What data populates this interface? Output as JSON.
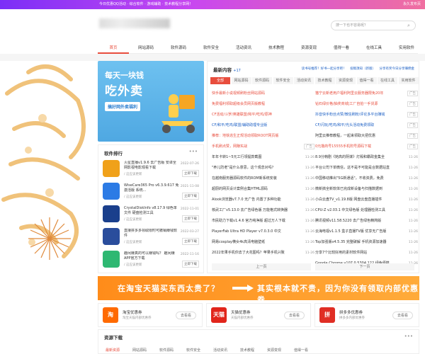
{
  "topbar": {
    "notice": "今日优惠QQ活动 · 综合软件 · 游戏辅助 · 技术教程分享网！",
    "right": "永久发布页"
  },
  "search": {
    "placeholder": "搜一下也不容易呢？"
  },
  "nav": [
    "首页",
    "网站源码",
    "软件源码",
    "软件安全",
    "活动资讯",
    "技术教程",
    "资源变现",
    "值得一看",
    "在线工具",
    "实用软件"
  ],
  "banner": {
    "line1": "每天一块钱",
    "line2": "吃外卖",
    "line3": "搞好网外卖福利"
  },
  "rank": {
    "title": "软件排行",
    "more": "•••",
    "items": [
      {
        "name": "火星直播v1.9.6 去广告版 安卓全网影视电影观看下载",
        "meta": "/ 这应该更新",
        "date": "2022-07-26",
        "btn": "立即下载",
        "color": "#f0a11a"
      },
      {
        "name": "WiseCare365 Pro v6.3.9.617 免激活版 系统...",
        "meta": "/ 这应该更新",
        "date": "2021-11-08",
        "btn": "立即下载",
        "color": "#2c7be5"
      },
      {
        "name": "CrystalDiskInfo v8.17.9 绿色单文件 硬盘检测工具",
        "meta": "/ 这应该更新",
        "date": "2022-11-01",
        "btn": "立即下载",
        "color": "#1a3f8c"
      },
      {
        "name": "直接拼多多领取限时可撤销赚钱软件",
        "meta": "/ 这应该更新",
        "date": "2022-03-27",
        "btn": "立即下载",
        "color": "#2a4d9c"
      },
      {
        "name": "趣闲赚真的可以赚钱吗？ 趣闲赚APP官方下载",
        "meta": "/ 这应该更新",
        "date": "2022-11-16",
        "btn": "立即下载",
        "color": "#2eb872"
      }
    ]
  },
  "latest": {
    "title": "最新内容",
    "count": "+17",
    "link1": "读书号推荐！好书一起分享吧！",
    "link2": "投稿须知（新版）",
    "link3": "分享有奖今日分享赚佣金",
    "tabs": [
      "全部",
      "网站源码",
      "软件源码",
      "软件安全",
      "活动资讯",
      "技术教程",
      "资源变现",
      "值得一看",
      "在线工具",
      "实用软件"
    ],
    "left": [
      {
        "t": "快手最新小说视频刷粉丝网站源码",
        "c": "red",
        "r": ""
      },
      {
        "t": "免费福利领取超级会员网页版教程",
        "c": "red",
        "r": ""
      },
      {
        "t": "CF活动/斗罗/英雄联盟/和平/吃鸡/原神",
        "c": "red",
        "r": ""
      },
      {
        "t": "CF/和平/吃鸡/联盟/辅助助理专业版",
        "c": "blue",
        "r": ""
      },
      {
        "t": "推荐：地铁逃生正规活动领取ROOT网页版",
        "c": "red",
        "r": ""
      },
      {
        "t": "手机刷点赞，网赚实战",
        "c": "red",
        "r": "广告"
      },
      {
        "t": "年年卡转1~5元工行领提款截图",
        "c": "",
        "r": "11-26"
      },
      {
        "t": "\"养儿防老\"是什么意思，这个观念对吗？",
        "c": "",
        "r": "11-26"
      },
      {
        "t": "在越南服务器源码软件的ROM新系统安装",
        "c": "",
        "r": "11-26"
      },
      {
        "t": "超厨的网页设计案例合集HTML源码",
        "c": "",
        "r": "11-26"
      },
      {
        "t": "Alook浏览器v7.7.0 无广告 内置了多种功能",
        "c": "",
        "r": "11-26"
      },
      {
        "t": "核武工厂v5.13.0 去广告绿色版 万能格式转换器",
        "c": "",
        "r": "11-26"
      },
      {
        "t": "市民助力下载v1.4.6 官方纯净版 超过万人下载",
        "c": "",
        "r": "11-26"
      },
      {
        "t": "PlayerFab Ultra HD Player v7.0.3.0 中文",
        "c": "",
        "r": "11-26"
      },
      {
        "t": "网易cosplay横女4k高清电脑壁纸",
        "c": "",
        "r": "11-26"
      },
      {
        "t": "2022年果手机你去了大花图吗？苹果手机兴致",
        "c": "",
        "r": "11-26"
      }
    ],
    "right": [
      {
        "t": "猫宁云新老用户福利阿里云服务器限免20年",
        "c": "red",
        "r": "广告"
      },
      {
        "t": "钻石绿价格/抽奖商城|工厂自拍一手货源",
        "c": "red",
        "r": "广告"
      },
      {
        "t": "抖音快手粉丝点赞/微信刷粉/评论多平台赚钱",
        "c": "blue",
        "r": "广告"
      },
      {
        "t": "CF/闪玩/吃鸡/和平/光头活动免费领取",
        "c": "blue",
        "r": "广告"
      },
      {
        "t": "阿里云推荐教程，一起来领取大把优惠",
        "c": "",
        "r": "广告"
      },
      {
        "t": "0元撸商号15555手机附号源码下载",
        "c": "red",
        "r": "广告"
      },
      {
        "t": "8.9分韩剧《她高的阴谋》灯殿和霸政金集全",
        "c": "",
        "r": "11-26"
      },
      {
        "t": "平台公司下单微信，这不是不可能是合数据站直",
        "c": "",
        "r": "11-26"
      },
      {
        "t": "中国移动推出\"5G新通话\"，不收资费，免费",
        "c": "",
        "r": "11-26"
      },
      {
        "t": "微新搞全新软体已完成新设备与扫描数据到",
        "c": "",
        "r": "11-26"
      },
      {
        "t": "小白云盘TV_v1.19.8版 网盘云盘直播插件",
        "c": "",
        "r": "11-26"
      },
      {
        "t": "CPU-Z v2.03.1 中文绿色版 处理器检测工具",
        "c": "",
        "r": "11-26"
      },
      {
        "t": "腾讯视频v11.58.5220 去广告绿色精简版",
        "c": "",
        "r": "11-26"
      },
      {
        "t": "云海电视v1.1.5 盒子直播TV版 优享无广告版",
        "c": "",
        "r": "11-26"
      },
      {
        "t": "Top加强版v4.5.35 完整破解 手机资源加速器",
        "c": "",
        "r": "11-26"
      },
      {
        "t": "分享7个比较好用的素材软件网站",
        "c": "",
        "r": "11-26"
      },
      {
        "t": "Google Chrome v107.0.5304.122 绿色便携",
        "c": "",
        "r": "11-26"
      }
    ],
    "prev": "上一页",
    "next": "下一页"
  },
  "bigbanner": {
    "left": "在淘宝天猫买东西太贵了？",
    "right": "其实根本就不贵，因为你没有领取内部优惠券"
  },
  "coupons": [
    {
      "title": "淘宝优惠券",
      "sub": "淘宝天猫内部优惠券",
      "btn": "去看看",
      "color": "#ff6a00",
      "icon": "淘"
    },
    {
      "title": "天猫优惠券",
      "sub": "天猫内部优惠券",
      "btn": "去看看",
      "color": "#e1251b",
      "icon": "天猫"
    },
    {
      "title": "拼多多优惠券",
      "sub": "拼多多内部优惠券",
      "btn": "去看看",
      "color": "#e02e24",
      "icon": "拼"
    }
  ],
  "resources": {
    "title": "资源下载",
    "more": "•••",
    "tabs": [
      "最新资源",
      "网站源码",
      "软件源码",
      "软件安全",
      "活动资讯",
      "技术教程",
      "资源变现",
      "值得一看"
    ]
  }
}
